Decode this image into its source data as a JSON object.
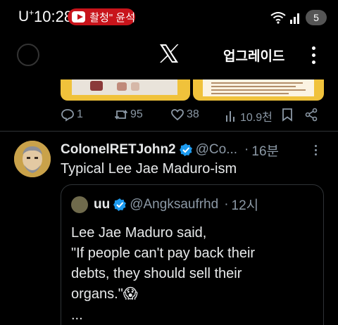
{
  "status_bar": {
    "carrier": "U",
    "carrier_sup": "+",
    "time": "10:28",
    "recording_label": "촬청\" 윤석",
    "battery": "5"
  },
  "header": {
    "upgrade_label": "업그레이드"
  },
  "prev_tweet_actions": {
    "replies": "1",
    "retweets": "95",
    "likes": "38",
    "views": "10.9천"
  },
  "tweet": {
    "author_name": "ColonelRETJohn2",
    "handle": "@Co...",
    "separator": "·",
    "time": "16분",
    "text": "Typical Lee Jae Maduro-ism"
  },
  "quoted_tweet": {
    "author_name": "uu",
    "handle": "@Angksaufrhd",
    "separator": "·",
    "time": "12시",
    "lines": [
      "Lee Jae Maduro said,",
      "\"If people can't pay back their",
      "debts, they should sell their",
      "organs.\"😱"
    ],
    "ellipsis": "..."
  },
  "colors": {
    "background": "#000000",
    "text_primary": "#e7e9ea",
    "text_secondary": "#8b98a5",
    "verified_blue": "#1d9bf0",
    "recording_red": "#c8141b"
  }
}
